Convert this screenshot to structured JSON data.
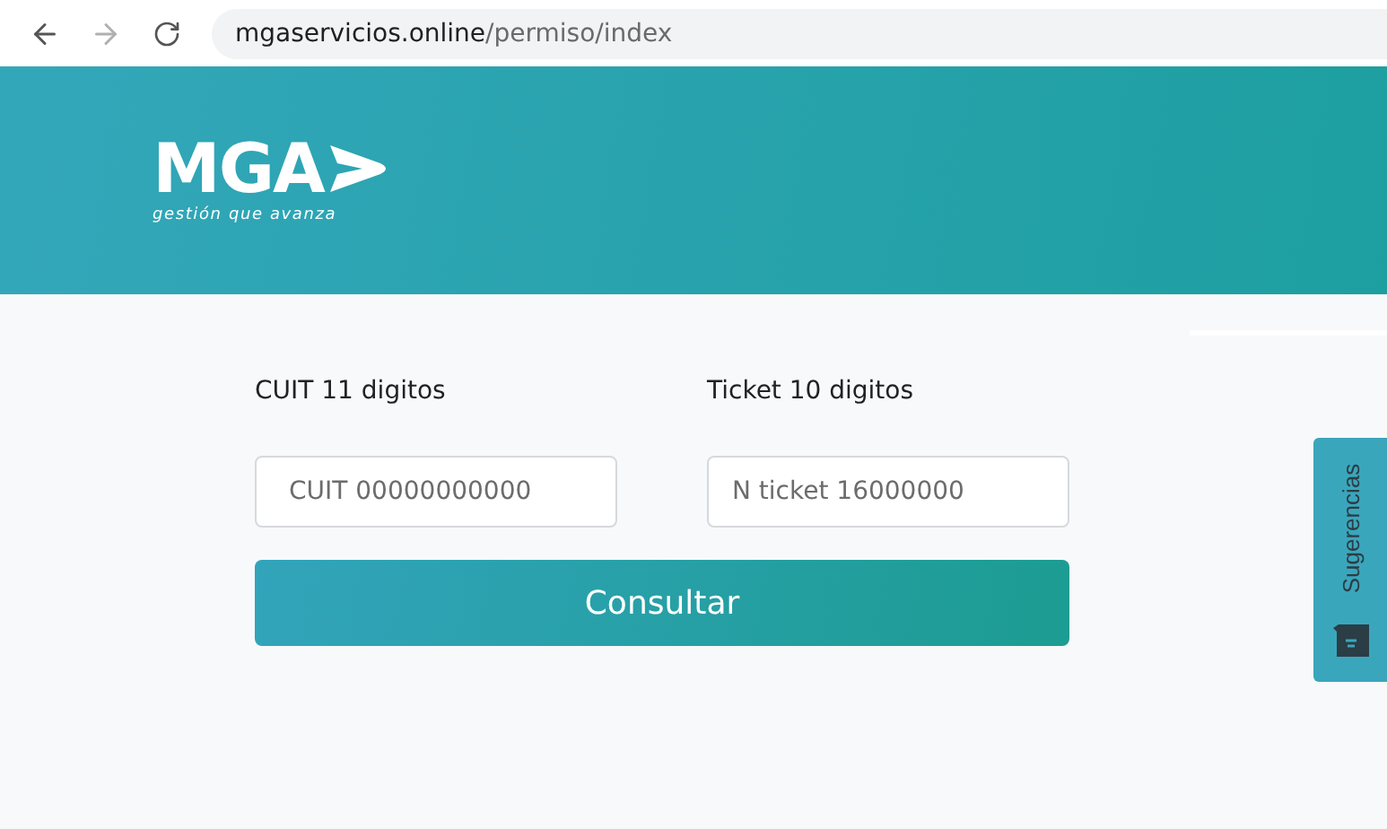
{
  "browser": {
    "url_host": "mgaservicios.online",
    "url_path": "/permiso/index"
  },
  "header": {
    "logo": {
      "mark": "MGA",
      "tagline": "gestión que avanza"
    }
  },
  "form": {
    "fields": [
      {
        "label": "CUIT 11 digitos",
        "placeholder": "CUIT 00000000000"
      },
      {
        "label": "Ticket 10 digitos",
        "placeholder": "N ticket 16000000"
      }
    ],
    "submit": "Consultar"
  },
  "feedback_tab": {
    "label": "Sugerencias"
  }
}
